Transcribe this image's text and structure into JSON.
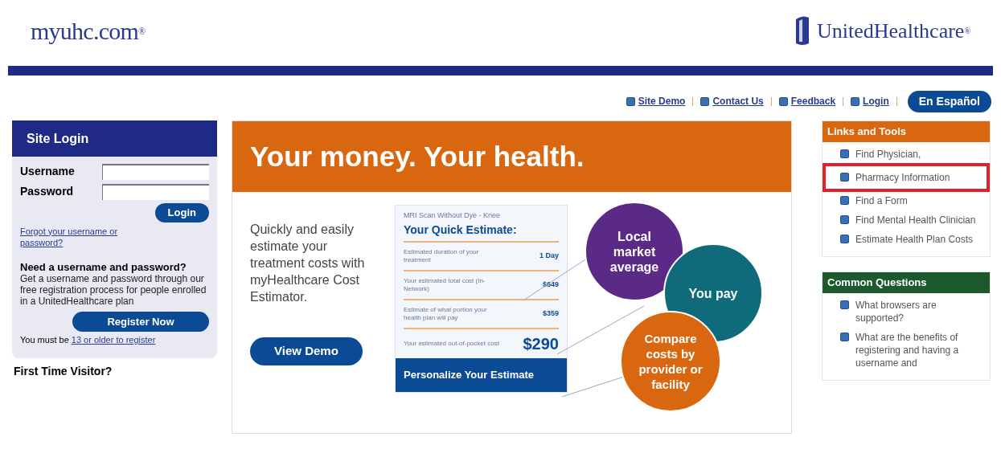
{
  "header": {
    "logo": "myuhc.com",
    "logo_mark": "®",
    "brand": "UnitedHealthcare",
    "brand_mark": "®"
  },
  "top_links": [
    {
      "label": "Site Demo"
    },
    {
      "label": "Contact Us"
    },
    {
      "label": "Feedback"
    },
    {
      "label": "Login"
    }
  ],
  "language_button": "En Español",
  "login": {
    "title": "Site Login",
    "username_label": "Username",
    "password_label": "Password",
    "login_button": "Login",
    "forgot_link": "Forgot your username or password?",
    "register_heading": "Need a username and password?",
    "register_text": "Get a username and password through our free registration process for people enrolled in a UnitedHealthcare plan",
    "register_button": "Register Now",
    "age_note": "You must be ",
    "age_link": "13 or older to register"
  },
  "first_time": "First Time Visitor?",
  "promo": {
    "headline": "Your money. Your health.",
    "text": "Quickly and easily estimate your treatment costs with myHealthcare Cost Estimator.",
    "demo_button": "View Demo",
    "estimate": {
      "procedure": "MRI Scan Without Dye - Knee",
      "title": "Your Quick Estimate:",
      "rows": [
        {
          "label": "Estimated duration of your treatment",
          "value": "1 Day",
          "kind": "small"
        },
        {
          "label": "Your estimated total cost (In-Network)",
          "value": "$649",
          "kind": "small"
        },
        {
          "label": "Estimate of what portion your health plan will pay",
          "value": "$359",
          "kind": "small"
        },
        {
          "label": "Your estimated out-of-pocket cost",
          "value": "$290",
          "kind": "large"
        }
      ],
      "button": "Personalize Your Estimate"
    },
    "bubbles": [
      {
        "label": "Local market average",
        "color": "#5b2a86"
      },
      {
        "label": "You pay",
        "color": "#0f6b7a"
      },
      {
        "label": "Compare costs by provider or facility",
        "color": "#d9670f"
      }
    ]
  },
  "links_and_tools": {
    "title": "Links and Tools",
    "items": [
      {
        "label": "Find Physician,",
        "highlighted": false
      },
      {
        "label": "Pharmacy Information",
        "highlighted": true
      },
      {
        "label": "Find a Form",
        "highlighted": false
      },
      {
        "label": "Find Mental Health Clinician",
        "highlighted": false
      },
      {
        "label": "Estimate Health Plan Costs",
        "highlighted": false
      }
    ]
  },
  "common_questions": {
    "title": "Common Questions",
    "items": [
      {
        "label": "What browsers are supported?"
      },
      {
        "label": "What are the benefits of registering and having a username and"
      }
    ]
  }
}
